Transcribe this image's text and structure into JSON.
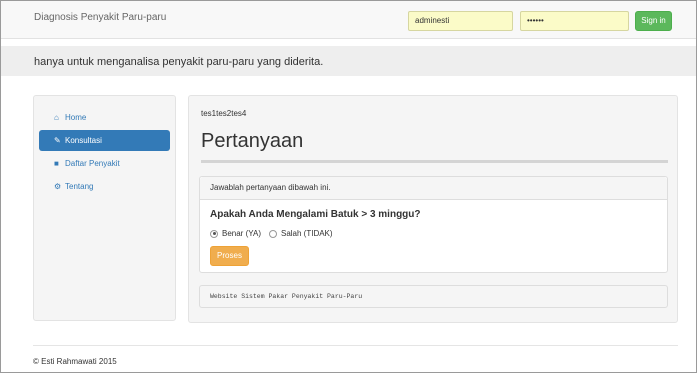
{
  "navbar": {
    "brand": "Diagnosis Penyakit Paru-paru",
    "username_value": "adminesti",
    "password_value": "••••••",
    "signin_label": "Sign in"
  },
  "tagline": "hanya untuk menganalisa penyakit paru-paru yang diderita.",
  "sidebar": {
    "items": [
      {
        "label": "Home",
        "icon": "home-icon"
      },
      {
        "label": "Konsultasi",
        "icon": "pencil-icon",
        "active": true
      },
      {
        "label": "Daftar Penyakit",
        "icon": "book-icon"
      },
      {
        "label": "Tentang",
        "icon": "cogs-icon"
      }
    ]
  },
  "main": {
    "crumb": "tes1tes2tes4",
    "title": "Pertanyaan",
    "panel_heading": "Jawablah pertanyaan dibawah ini.",
    "question": "Apakah Anda Mengalami Batuk > 3 minggu?",
    "options": [
      {
        "label": "Benar (YA)",
        "selected": true
      },
      {
        "label": "Salah (TIDAK)",
        "selected": false
      }
    ],
    "submit_label": "Proses",
    "footer_note": "Website Sistem Pakar Penyakit Paru-Paru"
  },
  "copyright": "© Esti Rahmawati 2015",
  "colors": {
    "primary": "#337ab7",
    "success": "#5cb85c",
    "warning": "#f0ad4e",
    "autofill": "#fbfbc8"
  }
}
